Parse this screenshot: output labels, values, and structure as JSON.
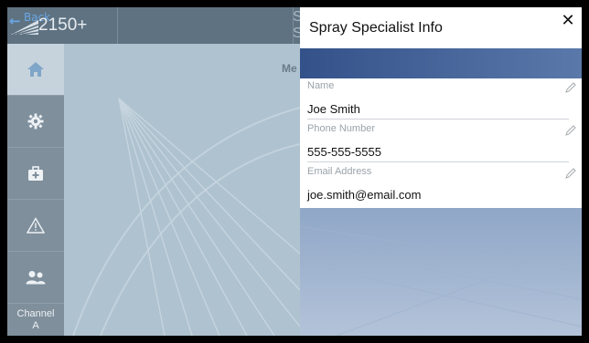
{
  "app": {
    "back_label": "Back",
    "model_label": "2150+",
    "menu_fragment": "Me",
    "topbar_fragment_1": "S",
    "topbar_fragment_2": "S",
    "channel_line1": "Channel",
    "channel_line2": "A"
  },
  "sidebar": {
    "items": [
      {
        "icon": "home-icon",
        "active": true
      },
      {
        "icon": "gear-icon",
        "active": false
      },
      {
        "icon": "first-aid-kit-icon",
        "active": false
      },
      {
        "icon": "warning-icon",
        "active": false
      },
      {
        "icon": "users-icon",
        "active": false
      }
    ]
  },
  "panel": {
    "title": "Spray Specialist Info",
    "close_symbol": "✕",
    "fields": [
      {
        "label": "Name",
        "value": "Joe Smith"
      },
      {
        "label": "Phone Number",
        "value": "555-555-5555"
      },
      {
        "label": "Email Address",
        "value": "joe.smith@email.com"
      }
    ]
  },
  "colors": {
    "accent_back": "#6aa7e6",
    "panel_band": "#34528a",
    "sidebar": "#7f8f9c"
  }
}
